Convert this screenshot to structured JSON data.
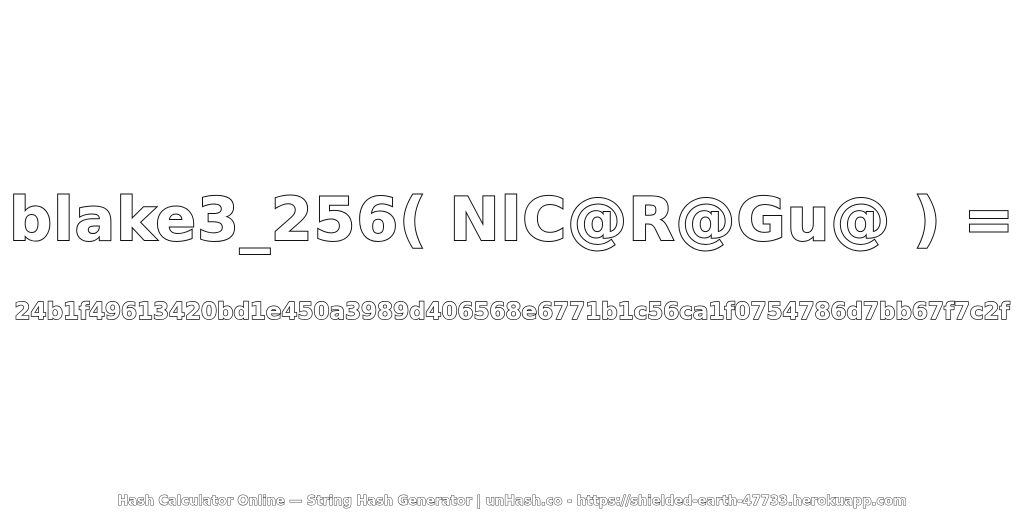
{
  "headline": {
    "text": "blake3_256( NlC@R@Gu@ ) ="
  },
  "hash": {
    "value": "24b1f49613420bd1e450a3989d406568e6771b1c56ca1f0754786d7bb67f7c2f"
  },
  "footer": {
    "text": "Hash Calculator Online — String Hash Generator | unHash.co - https://shielded-earth-47733.herokuapp.com"
  },
  "colors": {
    "text_fill": "#ffffff",
    "text_stroke": "#111111",
    "background": "#ffffff"
  }
}
